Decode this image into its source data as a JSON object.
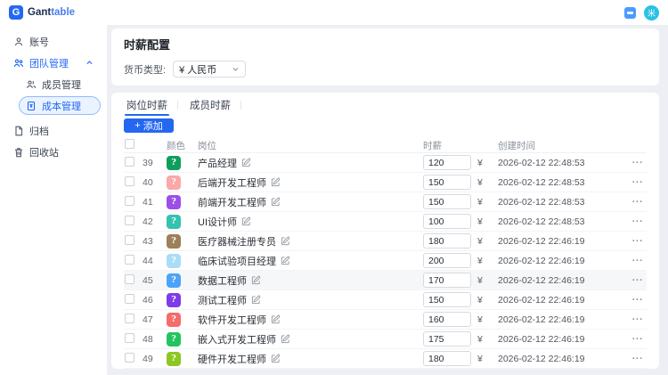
{
  "topbar": {
    "logo": {
      "mark": "G",
      "brand_dark": "Gant",
      "brand_blue": "table"
    },
    "help_icon": "help-icon",
    "avatar_text": "米"
  },
  "sidebar": {
    "items": [
      {
        "label": "账号",
        "icon": "user-icon"
      },
      {
        "label": "团队管理",
        "icon": "team-icon",
        "expanded": true
      },
      {
        "label": "成员管理",
        "icon": "members-icon"
      },
      {
        "label": "成本管理",
        "icon": "cost-icon",
        "selected": true
      },
      {
        "label": "归档",
        "icon": "archive-icon"
      },
      {
        "label": "回收站",
        "icon": "trash-icon"
      }
    ]
  },
  "header_card": {
    "title": "时薪配置",
    "currency_label": "货币类型:",
    "currency_value": "¥ 人民币"
  },
  "table_card": {
    "tabs": [
      {
        "label": "岗位时薪",
        "active": true
      },
      {
        "label": "成员时薪",
        "active": false
      }
    ],
    "add_button": {
      "icon": "+",
      "label": "添加"
    },
    "columns": {
      "color": "颜色",
      "position": "岗位",
      "rate": "时薪",
      "created": "创建时间"
    },
    "currency_symbol": "¥",
    "badge_glyph": "?",
    "more_label": "···",
    "rows": [
      {
        "id": 39,
        "color": "#0e9f5c",
        "position": "产品经理",
        "rate": "120",
        "created": "2026-02-12 22:48:53",
        "highlighted": false
      },
      {
        "id": 40,
        "color": "#fba8a8",
        "position": "后端开发工程师",
        "rate": "150",
        "created": "2026-02-12 22:48:53",
        "highlighted": false
      },
      {
        "id": 41,
        "color": "#9c4fe8",
        "position": "前端开发工程师",
        "rate": "150",
        "created": "2026-02-12 22:48:53",
        "highlighted": false
      },
      {
        "id": 42,
        "color": "#33c3ae",
        "position": "UI设计师",
        "rate": "100",
        "created": "2026-02-12 22:48:53",
        "highlighted": false
      },
      {
        "id": 43,
        "color": "#9d8057",
        "position": "医疗器械注册专员",
        "rate": "180",
        "created": "2026-02-12 22:46:19",
        "highlighted": false
      },
      {
        "id": 44,
        "color": "#a9ddf6",
        "position": "临床试验项目经理",
        "rate": "200",
        "created": "2026-02-12 22:46:19",
        "highlighted": false
      },
      {
        "id": 45,
        "color": "#4ba4f9",
        "position": "数据工程师",
        "rate": "170",
        "created": "2026-02-12 22:46:19",
        "highlighted": true
      },
      {
        "id": 46,
        "color": "#7d3bea",
        "position": "测试工程师",
        "rate": "150",
        "created": "2026-02-12 22:46:19",
        "highlighted": false
      },
      {
        "id": 47,
        "color": "#f66b6b",
        "position": "软件开发工程师",
        "rate": "160",
        "created": "2026-02-12 22:46:19",
        "highlighted": false
      },
      {
        "id": 48,
        "color": "#23c45f",
        "position": "嵌入式开发工程师",
        "rate": "175",
        "created": "2026-02-12 22:46:19",
        "highlighted": false
      },
      {
        "id": 49,
        "color": "#8cc722",
        "position": "硬件开发工程师",
        "rate": "180",
        "created": "2026-02-12 22:46:19",
        "highlighted": false
      }
    ]
  }
}
